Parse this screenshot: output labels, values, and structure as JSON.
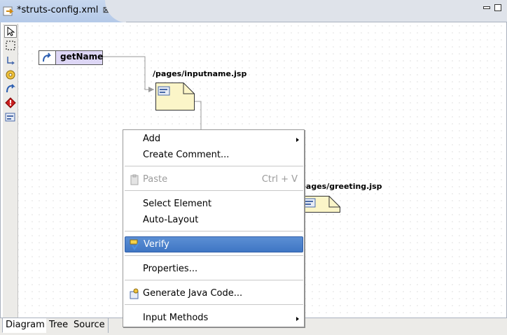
{
  "editor": {
    "tab_title": "*struts-config.xml",
    "close_glyph": "⊠"
  },
  "palette": {
    "tools": [
      "select-arrow-icon",
      "marquee-icon",
      "connection-icon",
      "gear-icon",
      "action-icon",
      "exception-icon",
      "page-icon"
    ]
  },
  "diagram": {
    "action_name": "getName",
    "page1_label": "/pages/inputname.jsp",
    "page2_label": "/pages/greeting.jsp"
  },
  "menu": {
    "add": "Add",
    "create_comment": "Create Comment...",
    "paste": "Paste",
    "paste_shortcut": "Ctrl + V",
    "select_element": "Select Element",
    "auto_layout": "Auto-Layout",
    "verify": "Verify",
    "properties": "Properties...",
    "generate_java": "Generate Java Code...",
    "input_methods": "Input Methods"
  },
  "bottom_tabs": [
    "Diagram",
    "Tree",
    "Source"
  ],
  "colors": {
    "selection": "#3f76c4",
    "action_fill": "#ddd6f5",
    "page_fill": "#fbf5c8"
  }
}
